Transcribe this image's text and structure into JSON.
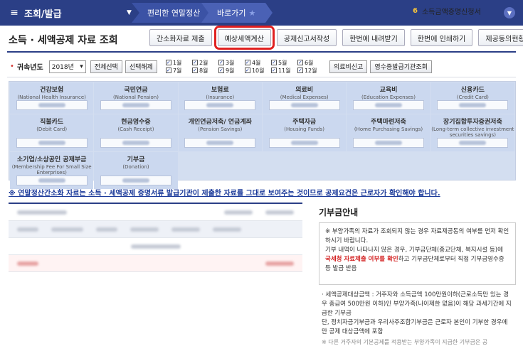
{
  "nav": {
    "main": "조회/발급",
    "crumb1": "편리한 연말정산",
    "crumb2": "바로가기",
    "right_num": "6",
    "right_label": "소득금액증명신청서"
  },
  "title": "소득 · 세액공제 자료 조회",
  "buttons": [
    "간소화자료 제출",
    "예상세액계산",
    "공제신고서작성",
    "한번에 내려받기",
    "한번에 인쇄하기",
    "제공동의현황"
  ],
  "highlighted_button_index": 1,
  "filter": {
    "label": "귀속년도",
    "year": "2018년",
    "select_all": "전체선택",
    "deselect": "선택해제",
    "months": [
      "1월",
      "2월",
      "3월",
      "4월",
      "5월",
      "6월",
      "7월",
      "8월",
      "9월",
      "10월",
      "11월",
      "12월"
    ],
    "btn_medical": "의료비신고",
    "btn_receipt": "영수증발급기관조회"
  },
  "categories": [
    {
      "name": "건강보험",
      "sub": "(National Health Insurance)"
    },
    {
      "name": "국민연금",
      "sub": "(National Pension)"
    },
    {
      "name": "보험료",
      "sub": "(Insurance)"
    },
    {
      "name": "의료비",
      "sub": "(Medical Expenses)"
    },
    {
      "name": "교육비",
      "sub": "(Education Expenses)"
    },
    {
      "name": "신용카드",
      "sub": "(Credit Card)"
    },
    {
      "name": "직불카드",
      "sub": "(Debit Card)"
    },
    {
      "name": "현금영수증",
      "sub": "(Cash Receipt)"
    },
    {
      "name": "개인연금저축/ 연금계좌",
      "sub": "(Pension Savings)"
    },
    {
      "name": "주택자금",
      "sub": "(Housing Funds)"
    },
    {
      "name": "주택마련저축",
      "sub": "(Home Purchasing Savings)"
    },
    {
      "name": "장기집합투자증권저축",
      "sub": "(Long-term collective investment securities savings)"
    },
    {
      "name": "소기업/소상공인 공제부금",
      "sub": "(Membership Fee For Small Size Enterprises)"
    },
    {
      "name": "기부금",
      "sub": "(Donation)"
    }
  ],
  "notice": "※ 연말정산간소화 자료는 소득 · 세액공제 증명서류 발급기관이 제출한 자료를 그대로 보여주는 것이므로 공제요건은 근로자가 확인해야 합니다.",
  "panel": {
    "title": "기부금안내",
    "box_line1": "※ 부양가족의 자료가 조회되지 않는 경우 자료제공동의 여부를 먼저 확인하시기 바랍니다.",
    "box_line2a": "기부 내역이 나타나지 않은 경우, 기부금단체(종교단체, 복지시설 등)에",
    "box_red": "국세청 자료제출 여부를 확인",
    "box_line2b": "하고 기부금단체로부터 직접 기부금영수증 등 발급 받음",
    "list_a": "· 세액공제대상금액 : 거주자와 소득금액 100만원이하(근로소득만 있는 경우 총급여 500만원 이하)인 부양가족(나이제한 없음)이 해당 과세기간에 지급한 기부금",
    "list_b": "단, 정치자금기부금과 우리사주조합기부금은 근로자 본인이 기부한 경우에만 공제 대상금액에 포함",
    "note": "※ 다른 거주자의 기본공제를 적용받는 부양가족이 지급한 기부금은 공"
  }
}
